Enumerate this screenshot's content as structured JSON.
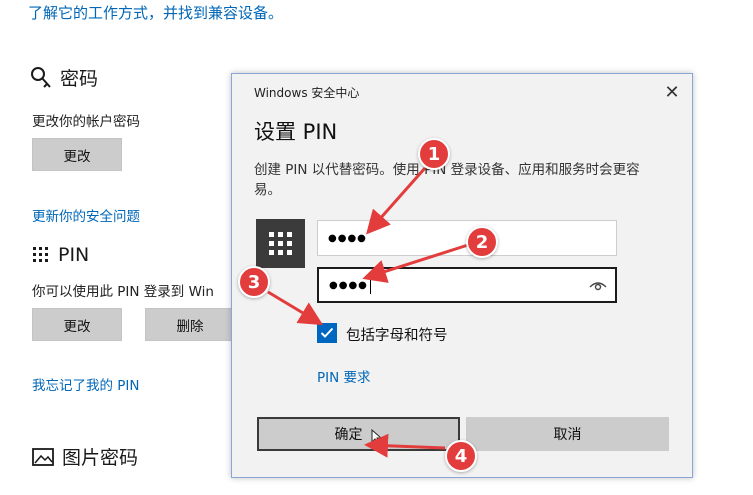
{
  "settings": {
    "intro_text": "了解它的工作方式，并找到兼容设备。",
    "password": {
      "title": "密码",
      "description": "更改你的帐户密码",
      "change_label": "更改"
    },
    "security_question_link": "更新你的安全问题",
    "pin": {
      "title": "PIN",
      "description": "你可以使用此 PIN 登录到 Win",
      "change_label": "更改",
      "remove_label": "删除"
    },
    "forgot_pin_link": "我忘记了我的 PIN",
    "picture_password": {
      "title": "图片密码"
    }
  },
  "dialog": {
    "window_title": "Windows 安全中心",
    "close_glyph": "✕",
    "heading": "设置 PIN",
    "description": "创建 PIN 以代替密码。使用 PIN 登录设备、应用和服务时会更容易。",
    "new_pin_value": "●●●●",
    "confirm_pin_value": "●●●●",
    "checkbox_label": "包括字母和符号",
    "checkbox_checked": true,
    "pin_requirements_link": "PIN 要求",
    "ok_label": "确定",
    "cancel_label": "取消"
  },
  "annotations": {
    "step1": "1",
    "step2": "2",
    "step3": "3",
    "step4": "4",
    "color": "#e23c3c"
  },
  "icons": [
    "key-icon",
    "keypad-icon",
    "picture-icon",
    "eye-icon",
    "close-icon",
    "checkmark-icon"
  ]
}
